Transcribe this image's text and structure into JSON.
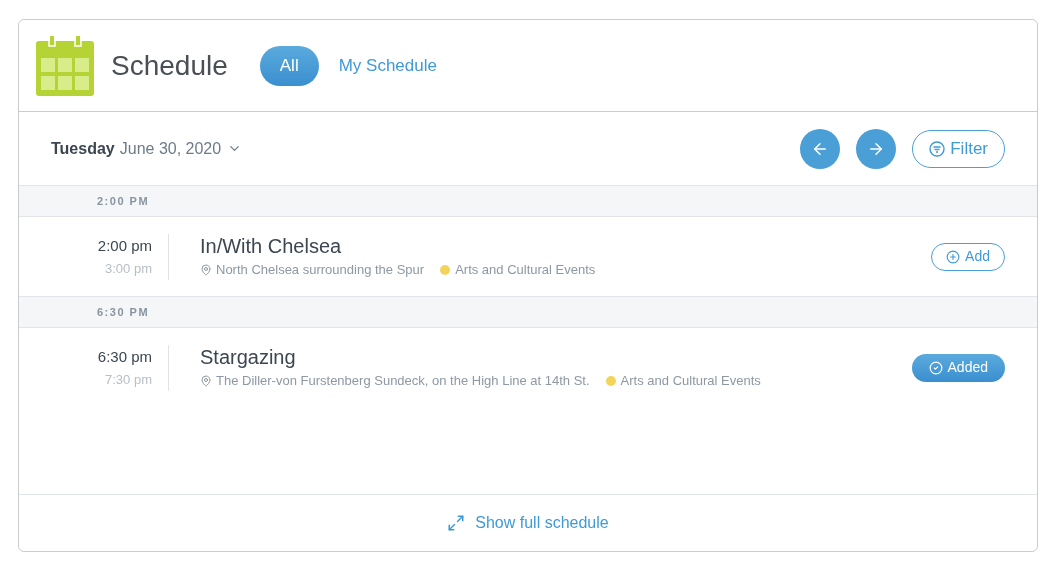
{
  "header": {
    "title": "Schedule",
    "tabs": [
      {
        "label": "All",
        "selected": true
      },
      {
        "label": "My Schedule",
        "selected": false
      }
    ]
  },
  "date_bar": {
    "weekday": "Tuesday",
    "date": "June 30, 2020",
    "filter_label": "Filter"
  },
  "groups": [
    {
      "heading": "2:00 PM",
      "events": [
        {
          "start": "2:00 pm",
          "end": "3:00 pm",
          "title": "In/With Chelsea",
          "location": "North Chelsea surrounding the Spur",
          "category": "Arts and Cultural Events",
          "color": "#f2d45c",
          "added": false,
          "button_label": "Add"
        }
      ]
    },
    {
      "heading": "6:30 PM",
      "events": [
        {
          "start": "6:30 pm",
          "end": "7:30 pm",
          "title": "Stargazing",
          "location": "The Diller-von Furstenberg Sundeck, on the High Line at 14th St.",
          "category": "Arts and Cultural Events",
          "color": "#f2d45c",
          "added": true,
          "button_label": "Added"
        }
      ]
    }
  ],
  "footer": {
    "link": "Show full schedule"
  }
}
